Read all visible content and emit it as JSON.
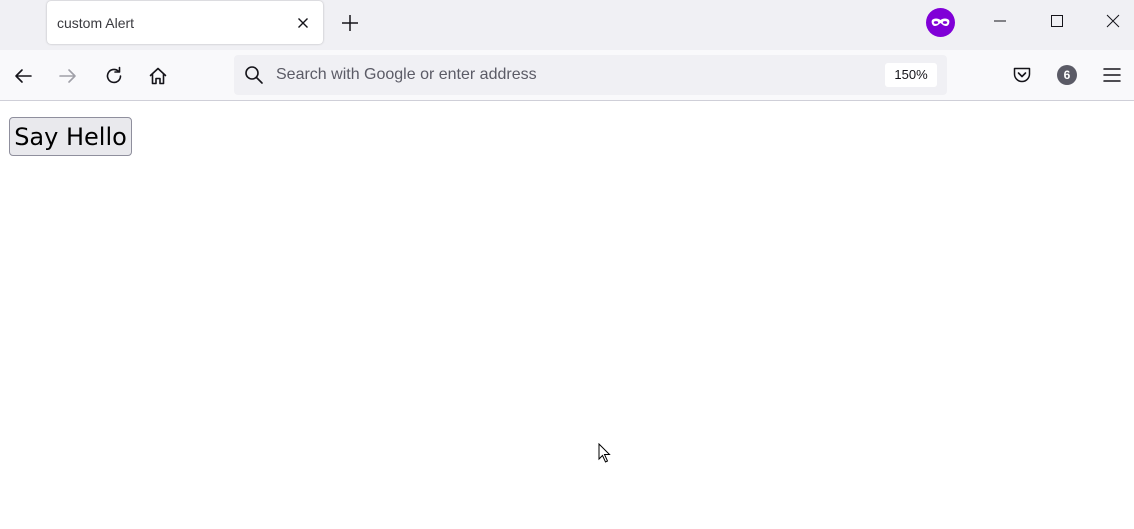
{
  "browser": {
    "tab": {
      "title": "custom Alert"
    },
    "urlbar": {
      "placeholder": "Search with Google or enter address",
      "zoom": "150%"
    },
    "extensions_badge": "6",
    "colors": {
      "private_badge": "#8000d7"
    },
    "icons": [
      "new-tab-icon",
      "private-browsing-icon",
      "minimize-icon",
      "maximize-icon",
      "close-window-icon",
      "back-icon",
      "forward-icon",
      "reload-icon",
      "home-icon",
      "search-icon",
      "pocket-icon",
      "menu-icon"
    ]
  },
  "page": {
    "button_label": "Say Hello"
  }
}
